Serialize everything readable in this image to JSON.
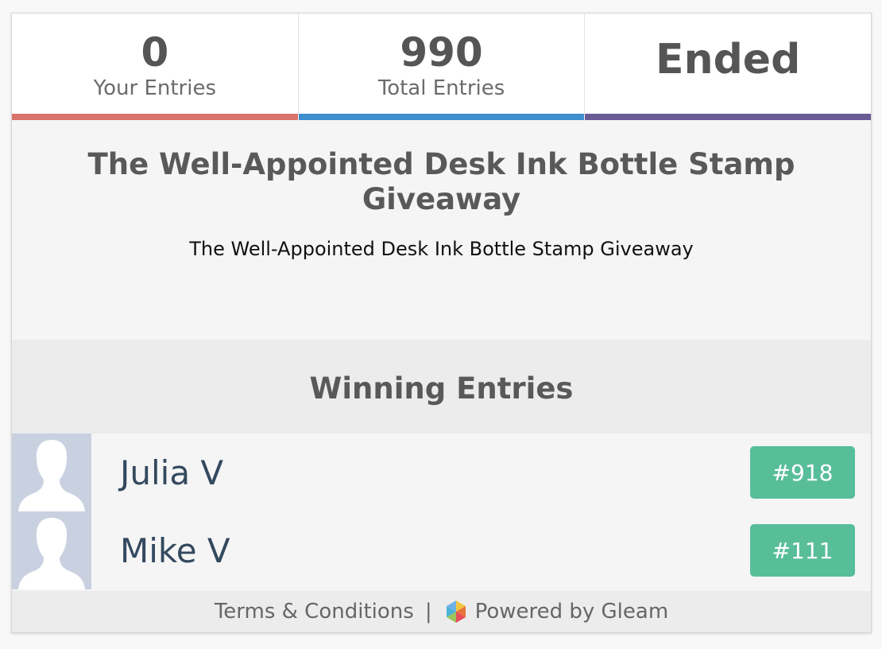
{
  "stats": {
    "your_entries": {
      "value": "0",
      "label": "Your Entries"
    },
    "total_entries": {
      "value": "990",
      "label": "Total Entries"
    },
    "status": "Ended"
  },
  "colors": {
    "your_entries_bar": "#d9736c",
    "total_entries_bar": "#3e8ed0",
    "status_bar": "#6b5b95",
    "entry_badge": "#58be9a",
    "winner_name": "#34495e"
  },
  "giveaway": {
    "title": "The Well-Appointed Desk Ink Bottle Stamp Giveaway",
    "description": "The Well-Appointed Desk Ink Bottle Stamp Giveaway"
  },
  "winners": {
    "heading": "Winning Entries",
    "items": [
      {
        "name": "Julia V",
        "entry": "#918",
        "avatar_icon": "default-user-silhouette"
      },
      {
        "name": "Mike V",
        "entry": "#111",
        "avatar_icon": "default-user-silhouette"
      }
    ]
  },
  "footer": {
    "terms_label": "Terms & Conditions",
    "separator": "|",
    "powered_label": "Powered by Gleam",
    "logo_icon": "gleam-logo-icon"
  }
}
